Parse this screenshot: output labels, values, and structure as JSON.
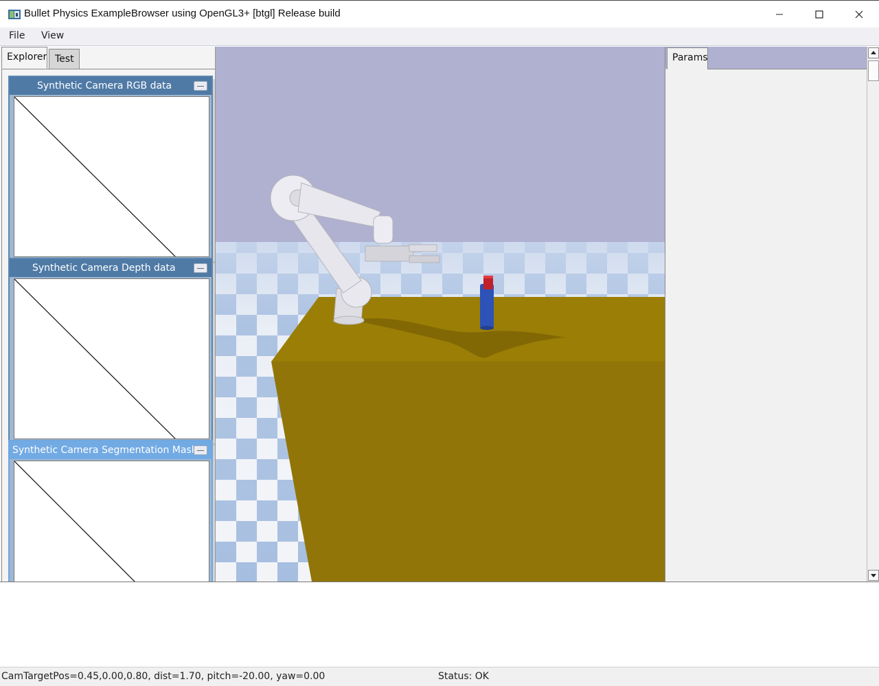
{
  "window": {
    "title": "Bullet Physics ExampleBrowser using OpenGL3+ [btgl] Release build",
    "icon": "app-icon",
    "controls": [
      "minimize-icon",
      "maximize-icon",
      "close-icon"
    ]
  },
  "menu": {
    "file_label": "File",
    "view_label": "View"
  },
  "left_panel": {
    "tabs": [
      {
        "label": "Explorer"
      },
      {
        "label": "Test"
      }
    ],
    "camera_windows": [
      {
        "title": "Synthetic Camera RGB data"
      },
      {
        "title": "Synthetic Camera Depth data"
      },
      {
        "title": "Synthetic Camera Segmentation Mask"
      }
    ]
  },
  "right_panel": {
    "tab_label": "Params"
  },
  "statusbar": {
    "camera_text": "CamTargetPos=0.45,0.00,0.80, dist=1.70, pitch=-20.00, yaw=0.00",
    "status_text": "Status: OK"
  },
  "colors": {
    "sky": "#b0b0d0",
    "table": "#9a7e06",
    "checker_blue": "#a6bee0",
    "checker_white": "#f2f4f8",
    "cube_blue": "#2d52b8",
    "cube_red": "#c0202a",
    "camera_title_inactive": "#4f7aa6",
    "camera_title_active": "#72aae4"
  }
}
